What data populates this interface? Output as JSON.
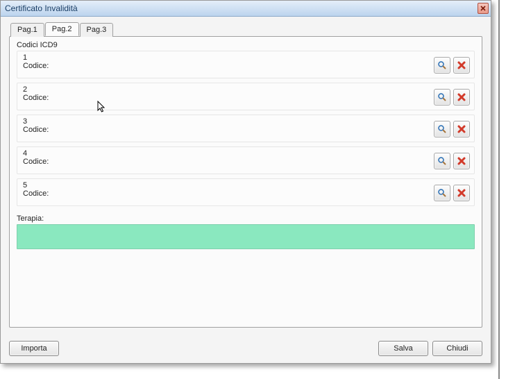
{
  "window": {
    "title": "Certificato Invalidità"
  },
  "tabs": [
    {
      "label": "Pag.1"
    },
    {
      "label": "Pag.2"
    },
    {
      "label": "Pag.3"
    }
  ],
  "active_tab": 1,
  "section": {
    "title": "Codici ICD9",
    "code_label": "Codice:",
    "rows": [
      {
        "num": "1"
      },
      {
        "num": "2"
      },
      {
        "num": "3"
      },
      {
        "num": "4"
      },
      {
        "num": "5"
      }
    ]
  },
  "terapia": {
    "label": "Terapia:",
    "value": ""
  },
  "buttons": {
    "importa": "Importa",
    "salva": "Salva",
    "chiudi": "Chiudi"
  }
}
